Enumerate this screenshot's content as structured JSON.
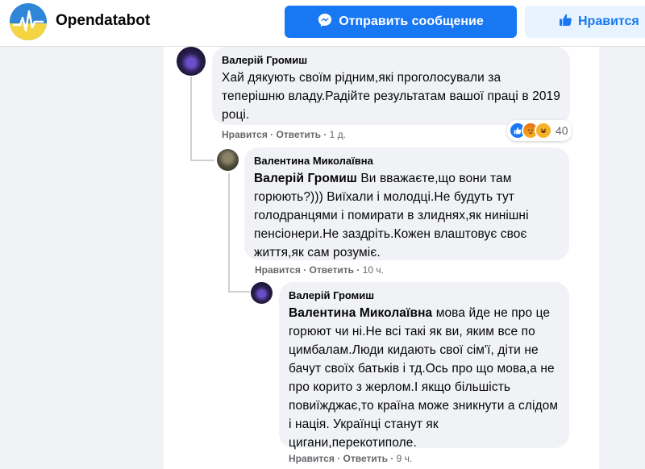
{
  "header": {
    "page_name": "Opendatabot",
    "message_button": "Отправить сообщение",
    "like_button": "Нравится"
  },
  "comments": [
    {
      "author": "Валерій Громиш",
      "mention": "",
      "text": "Хай дякують своїм рідним,які проголосували за теперішню владу.Радійте результатам вашої праці в 2019 році.",
      "like": "Нравится",
      "reply": "Ответить",
      "time": "1 д.",
      "reactions_count": "40"
    },
    {
      "author": "Валентина Миколаївна",
      "mention": "Валерій Громиш",
      "text": "Ви вважаєте,що вони там горюють?))) Виїхали і молодці.Не будуть тут голодранцями і помирати в злиднях,як нинішні пенсіонери.Не заздріть.Кожен влаштовує своє життя,як сам розуміє.",
      "like": "Нравится",
      "reply": "Ответить",
      "time": "10 ч."
    },
    {
      "author": "Валерій Громиш",
      "mention": "Валентина Миколаївна",
      "text": "мова йде не про це горюют чи ні.Не всі такі як ви, яким все по цимбалам.Люди кидають свої сім'ї, діти не бачут своїх батьків і тд.Ось про що мова,а не про корито з жерлом.І якщо більшість повиїжджає,то країна може зникнути а слідом і нація. Українці станут як цигани,перекотиполе.",
      "like": "Нравится",
      "reply": "Ответить",
      "time": "9 ч."
    }
  ],
  "colors": {
    "brand_blue": "#1877f2",
    "bubble_bg": "#f0f2f5",
    "meta_gray": "#65676b"
  },
  "icons": {
    "messenger": "messenger-icon",
    "like": "thumbs-up-icon"
  }
}
